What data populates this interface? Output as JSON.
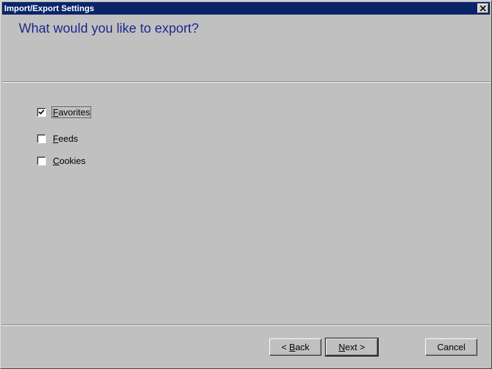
{
  "window": {
    "title": "Import/Export Settings"
  },
  "heading": "What would you like to export?",
  "options": [
    {
      "pre": "",
      "mnemonic": "F",
      "post": "avorites",
      "checked": true
    },
    {
      "pre": "",
      "mnemonic": "F",
      "post": "eeds",
      "checked": false
    },
    {
      "pre": "",
      "mnemonic": "C",
      "post": "ookies",
      "checked": false
    }
  ],
  "buttons": {
    "back": {
      "pre": "< ",
      "mnemonic": "B",
      "post": "ack"
    },
    "next": {
      "pre": "",
      "mnemonic": "N",
      "post": "ext >"
    },
    "cancel": {
      "label": "Cancel"
    }
  },
  "icons": {
    "close": "close-icon",
    "check": "checkmark-icon"
  },
  "colors": {
    "titlebar": "#0a246a",
    "heading": "#1c2a8c",
    "face": "#c0c0c0"
  }
}
